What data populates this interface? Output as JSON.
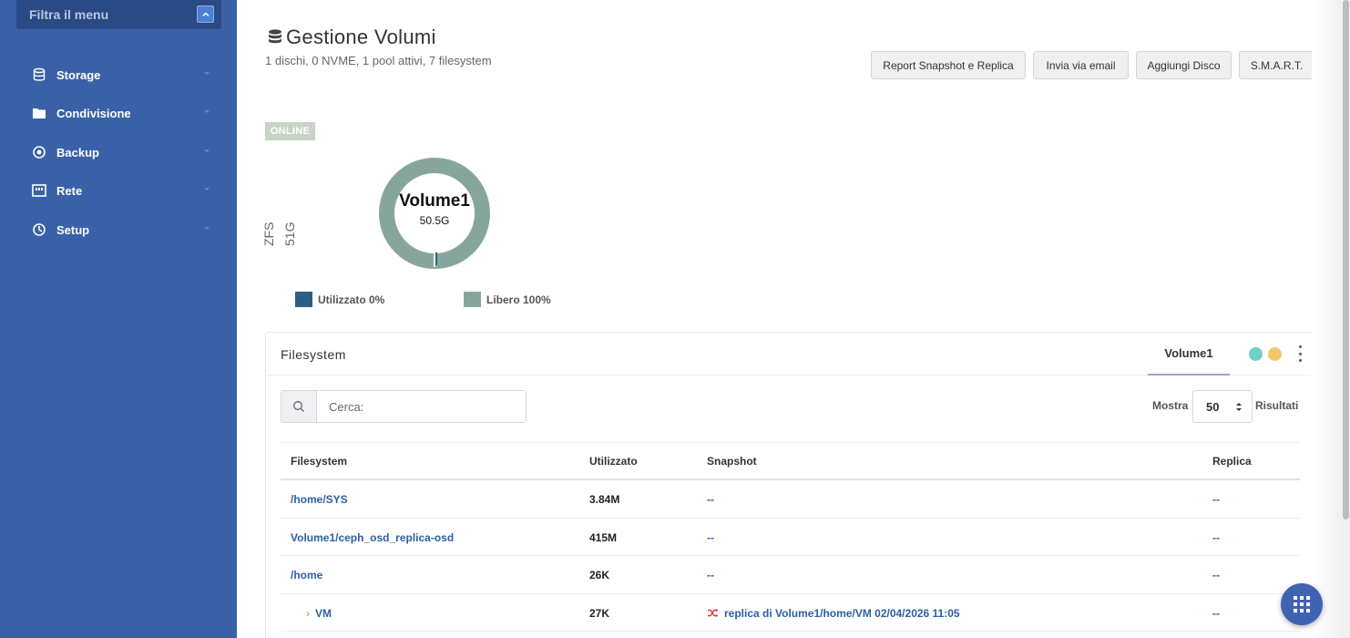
{
  "sidebar": {
    "filter_label": "Filtra il menu",
    "items": [
      {
        "label": "Storage",
        "icon": "database-icon"
      },
      {
        "label": "Condivisione",
        "icon": "folder-icon"
      },
      {
        "label": "Backup",
        "icon": "backup-icon"
      },
      {
        "label": "Rete",
        "icon": "network-icon"
      },
      {
        "label": "Setup",
        "icon": "setup-icon"
      }
    ],
    "colors": {
      "background": "#3a61a8",
      "filter_bg": "#2a4a86"
    }
  },
  "header": {
    "title": "Gestione Volumi",
    "subtitle": "1 dischi, 0 NVME, 1 pool attivi, 7 filesystem",
    "buttons": [
      "Report Snapshot e Replica",
      "Invia via email",
      "Aggiungi Disco",
      "S.M.A.R.T."
    ]
  },
  "pool": {
    "status": "ONLINE",
    "type": "ZFS",
    "size": "51G",
    "name": "Volume1",
    "capacity": "50.5G",
    "used_fraction": 0.0,
    "legend": {
      "used": "Utilizzato 0%",
      "free": "Libero 100%"
    },
    "colors": {
      "used": "#2c5f86",
      "free": "#87a69b",
      "status_bg": "#c7d4c6"
    }
  },
  "panel": {
    "title": "Filesystem",
    "active_tab": "Volume1",
    "status_colors": [
      "#6fd1c9",
      "#f2c76a"
    ],
    "search": {
      "placeholder": "Cerca:",
      "value": ""
    },
    "show_label": "Mostra",
    "page_size": "50",
    "results_label": "Risultati",
    "table": {
      "columns": [
        "Filesystem",
        "Utilizzato",
        "Snapshot",
        "Replica"
      ],
      "rows": [
        {
          "filesystem": "/home/SYS",
          "used": "3.84M",
          "snapshot": "--",
          "replica": "--",
          "child": false
        },
        {
          "filesystem": "Volume1/ceph_osd_replica-osd",
          "used": "415M",
          "snapshot": "--",
          "replica": "--",
          "child": false
        },
        {
          "filesystem": "/home",
          "used": "26K",
          "snapshot": "--",
          "replica": "--",
          "child": false
        },
        {
          "filesystem": "VM",
          "used": "27K",
          "snapshot": "replica di Volume1/home/VM 02/04/2026 11:05",
          "replica": "--",
          "child": true
        }
      ]
    }
  }
}
